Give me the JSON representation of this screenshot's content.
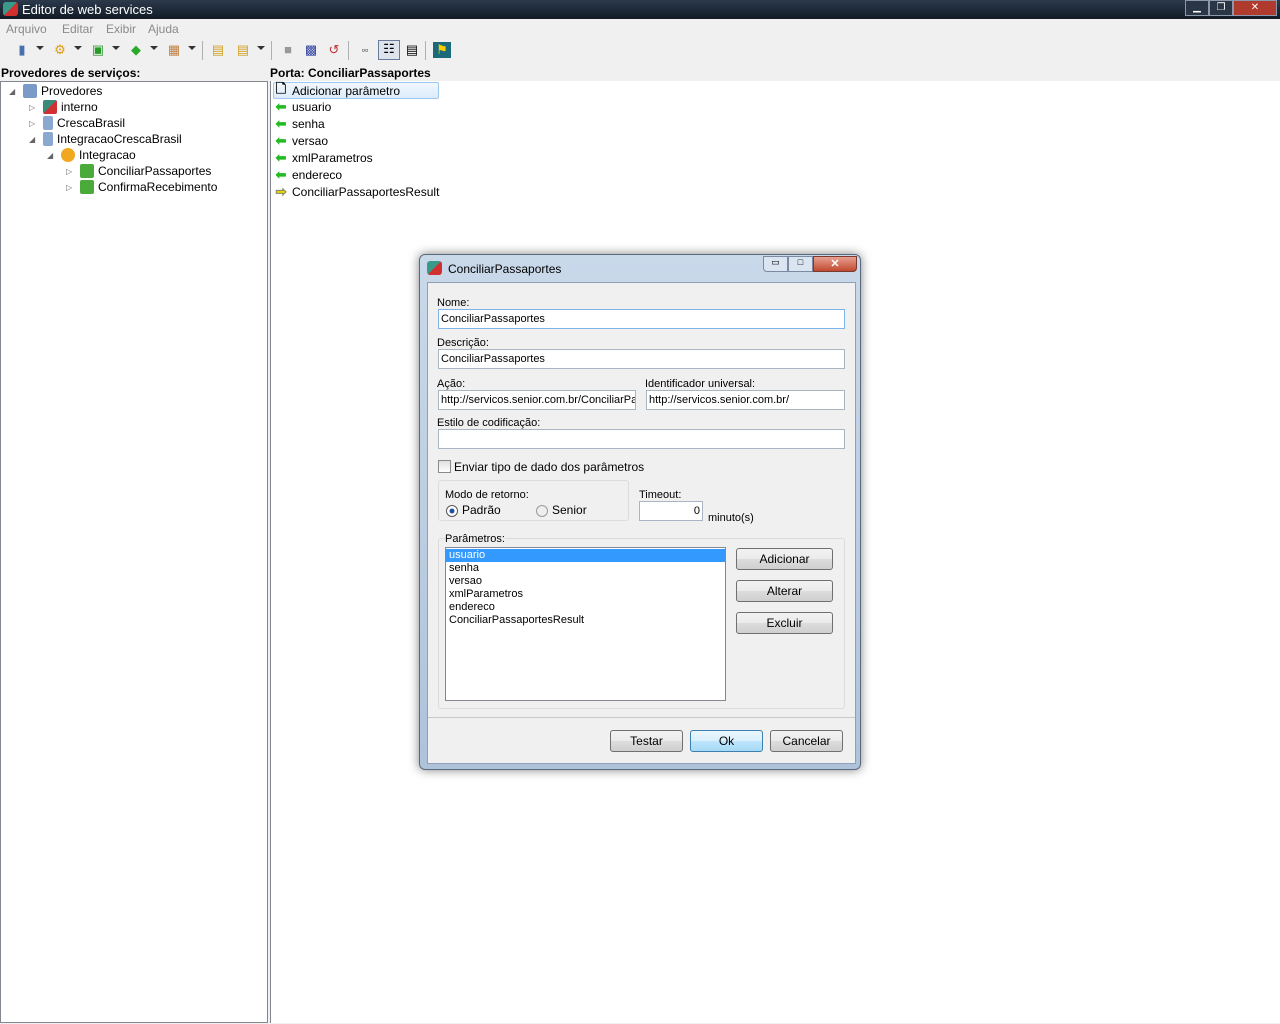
{
  "window": {
    "title": "Editor de web services",
    "controls": [
      "minimize",
      "restore",
      "close"
    ]
  },
  "menu": [
    "Arquivo",
    "Editar",
    "Exibir",
    "Ajuda"
  ],
  "toolbar": [
    "providers-icon",
    "service-icon",
    "port-icon",
    "operation-icon",
    "schedule-icon",
    "import-icon",
    "export-icon",
    "stop-icon",
    "save-icon",
    "undo-icon",
    "small-icons-icon",
    "details-view-icon",
    "list-view-icon",
    "run-icon"
  ],
  "left": {
    "header": "Provedores de serviços:",
    "tree": [
      {
        "label": "Provedores",
        "level": 0,
        "icon": "providers",
        "expanded": true
      },
      {
        "label": "interno",
        "level": 1,
        "icon": "internal",
        "expanded": false
      },
      {
        "label": "CrescaBrasil",
        "level": 1,
        "icon": "server",
        "expanded": false
      },
      {
        "label": "IntegracaoCrescaBrasil",
        "level": 1,
        "icon": "server",
        "expanded": true
      },
      {
        "label": "Integracao",
        "level": 2,
        "icon": "service",
        "expanded": true
      },
      {
        "label": "ConciliarPassaportes",
        "level": 3,
        "icon": "port",
        "expanded": false
      },
      {
        "label": "ConfirmaRecebimento",
        "level": 3,
        "icon": "port",
        "expanded": false
      }
    ]
  },
  "right": {
    "header": "Porta: ConciliarPassaportes",
    "items": [
      {
        "label": "Adicionar parâmetro",
        "icon": "new-doc",
        "selected": true
      },
      {
        "label": "usuario",
        "icon": "input-arrow"
      },
      {
        "label": "senha",
        "icon": "input-arrow"
      },
      {
        "label": "versao",
        "icon": "input-arrow"
      },
      {
        "label": "xmlParametros",
        "icon": "input-arrow"
      },
      {
        "label": "endereco",
        "icon": "input-arrow"
      },
      {
        "label": "ConciliarPassaportesResult",
        "icon": "output-arrow"
      }
    ]
  },
  "dialog": {
    "title": "ConciliarPassaportes",
    "nome_label": "Nome:",
    "nome": "ConciliarPassaportes",
    "descricao_label": "Descrição:",
    "descricao": "ConciliarPassaportes",
    "acao_label": "Ação:",
    "acao": "http://servicos.senior.com.br/ConciliarPassaportes",
    "uid_label": "Identificador universal:",
    "uid": "http://servicos.senior.com.br/",
    "estilo_label": "Estilo de codificação:",
    "estilo": "",
    "enviar_tipo_label": "Enviar tipo de dado dos parâmetros",
    "enviar_tipo_checked": false,
    "modo_label": "Modo de retorno:",
    "modo_options": [
      "Padrão",
      "Senior"
    ],
    "modo_selected": "Padrão",
    "timeout_label": "Timeout:",
    "timeout": "0",
    "timeout_unit": "minuto(s)",
    "parametros_label": "Parâmetros:",
    "parametros": [
      "usuario",
      "senha",
      "versao",
      "xmlParametros",
      "endereco",
      "ConciliarPassaportesResult"
    ],
    "parametros_selected": "usuario",
    "adicionar": "Adicionar",
    "alterar": "Alterar",
    "excluir": "Excluir",
    "testar": "Testar",
    "ok": "Ok",
    "cancelar": "Cancelar"
  },
  "colors": {
    "titlebar": "#1a2433",
    "selection": "#3399ff",
    "input_arrow": "#22bb22",
    "output_arrow": "#e8d800"
  }
}
